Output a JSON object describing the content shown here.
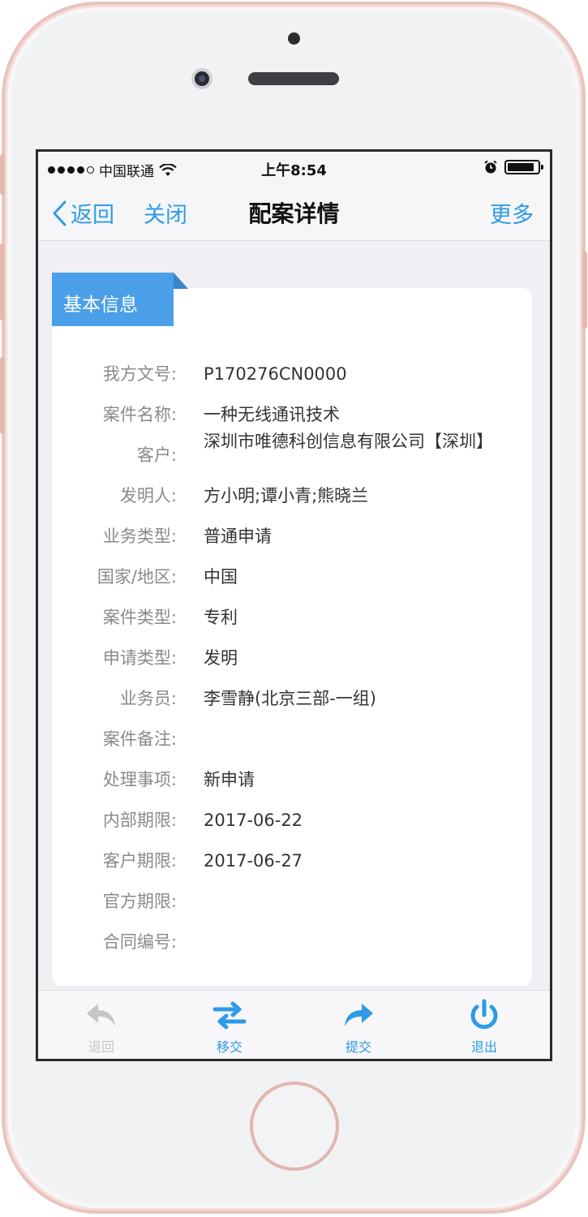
{
  "status": {
    "carrier": "中国联通",
    "time": "上午8:54"
  },
  "nav": {
    "back_label": "返回",
    "close_label": "关闭",
    "title": "配案详情",
    "more_label": "更多"
  },
  "section": {
    "title": "基本信息"
  },
  "fields": [
    {
      "label": "我方文号:",
      "value": "P170276CN0000"
    },
    {
      "label": "案件名称:",
      "value": "一种无线通讯技术"
    },
    {
      "label": "客户:",
      "value": "深圳市唯德科创信息有限公司【深圳】"
    },
    {
      "label": "发明人:",
      "value": "方小明;谭小青;熊晓兰"
    },
    {
      "label": "业务类型:",
      "value": "普通申请"
    },
    {
      "label": "国家/地区:",
      "value": "中国"
    },
    {
      "label": "案件类型:",
      "value": "专利"
    },
    {
      "label": "申请类型:",
      "value": "发明"
    },
    {
      "label": "业务员:",
      "value": "李雪静(北京三部-一组)"
    },
    {
      "label": "案件备注:",
      "value": ""
    },
    {
      "label": "处理事项:",
      "value": "新申请"
    },
    {
      "label": "内部期限:",
      "value": "2017-06-22"
    },
    {
      "label": "客户期限:",
      "value": "2017-06-27"
    },
    {
      "label": "官方期限:",
      "value": ""
    },
    {
      "label": "合同编号:",
      "value": ""
    }
  ],
  "tabbar": {
    "back_label": "退回",
    "transfer_label": "移交",
    "submit_label": "提交",
    "exit_label": "退出"
  },
  "colors": {
    "accent": "#2d9be6",
    "section_tab": "#4a9fe8",
    "disabled": "#c6c6c6"
  }
}
